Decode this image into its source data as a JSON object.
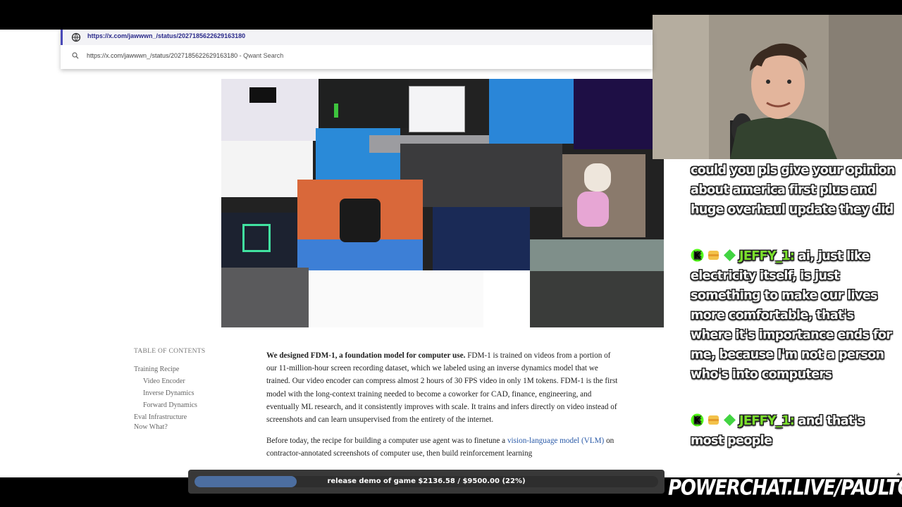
{
  "browser": {
    "url": "https://x.com/jawwwn_/status/2027185622629163180",
    "suggestion_url": "https://x.com/jawwwn_/status/2027185622629163180",
    "suggestion_engine": "- Qwant Search"
  },
  "toc": {
    "heading": "TABLE OF CONTENTS",
    "items": [
      {
        "label": "Training Recipe"
      },
      {
        "label": "Video Encoder"
      },
      {
        "label": "Inverse Dynamics"
      },
      {
        "label": "Forward Dynamics"
      },
      {
        "label": "Eval Infrastructure"
      },
      {
        "label": "Now What?"
      }
    ]
  },
  "article": {
    "p1_lead": "We designed FDM-1, a foundation model for computer use.",
    "p1_body": " FDM-1 is trained on videos from a portion of our 11-million-hour screen recording dataset, which we labeled using an inverse dynamics model that we trained. Our video encoder can compress almost 2 hours of 30 FPS video in only 1M tokens. FDM-1 is the first model with the long-context training needed to become a coworker for CAD, finance, engineering, and eventually ML research, and it consistently improves with scale. It trains and infers directly on video instead of screenshots and can learn unsupervised from the entirety of the internet.",
    "p2_start": "Before today, the recipe for building a computer use agent was to finetune a ",
    "p2_link": "vision-language model (VLM)",
    "p2_end": " on contractor-annotated screenshots of computer use, then build reinforcement learning"
  },
  "chat": {
    "messages": [
      {
        "user": "",
        "text": "could you pls give your opinion about america first plus and huge overhaul update they did"
      },
      {
        "user": "JEFFY_1:",
        "text": "ai, just like electricity itself, is just something to make our lives more comfortable, that's where it's importance ends for me, because I'm not a person who's into computers"
      },
      {
        "user": "JEFFY_1:",
        "text": "and that's most people"
      }
    ]
  },
  "goal": {
    "label": "release demo of game $2136.58 / $9500.00 (22%)",
    "fraction": 0.22
  },
  "brand": "POWERCHAT.LIVE/PAULTOWN",
  "colors": {
    "link": "#2a5aa8",
    "chat_username": "#7be02c",
    "progress_fill": "#4c6ea0"
  }
}
